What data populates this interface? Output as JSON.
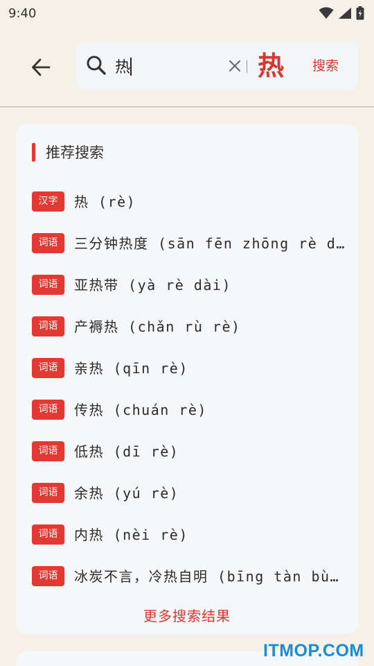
{
  "status_bar": {
    "time": "9:40"
  },
  "search": {
    "query": "热",
    "preview_char": "热",
    "button_label": "搜索"
  },
  "recommend": {
    "title": "推荐搜索",
    "items": [
      {
        "tag": "汉字",
        "text": "热 (rè)"
      },
      {
        "tag": "词语",
        "text": "三分钟热度 (sān fēn zhōng rè dù)"
      },
      {
        "tag": "词语",
        "text": "亚热带 (yà rè dài)"
      },
      {
        "tag": "词语",
        "text": "产褥热 (chǎn rù rè)"
      },
      {
        "tag": "词语",
        "text": "亲热 (qīn rè)"
      },
      {
        "tag": "词语",
        "text": "传热 (chuán rè)"
      },
      {
        "tag": "词语",
        "text": "低热 (dī rè)"
      },
      {
        "tag": "词语",
        "text": "余热 (yú rè)"
      },
      {
        "tag": "词语",
        "text": "内热 (nèi rè)"
      },
      {
        "tag": "词语",
        "text": "冰炭不言，冷热自明 (bīng tàn bù yán，lěng rè zì míng)"
      }
    ],
    "more_label": "更多搜索结果"
  },
  "watermark": "ITMOP.COM",
  "colors": {
    "accent": "#e23a33",
    "background": "#f6f1e6",
    "card": "#f6f7f9"
  }
}
